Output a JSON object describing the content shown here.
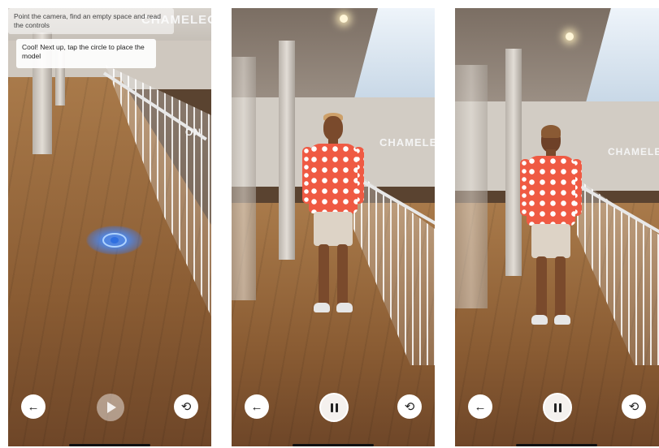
{
  "screens": [
    {
      "instruction_text": "Point the camera, find an empty space and read the controls",
      "tip_text": "Cool! Next up, tap the circle to place the model",
      "sign_text": "CHAMELEON",
      "sign_text_secondary": "ON",
      "controls": {
        "back_icon": "arrow-left-icon",
        "play_icon": "play-icon",
        "reset_icon": "rotate-ccw-icon"
      }
    },
    {
      "sign_text": "CHAMELEO",
      "controls": {
        "back_icon": "arrow-left-icon",
        "pause_icon": "pause-icon",
        "reset_icon": "rotate-ccw-icon"
      }
    },
    {
      "sign_text": "CHAMELE",
      "controls": {
        "back_icon": "arrow-left-icon",
        "pause_icon": "pause-icon",
        "reset_icon": "rotate-ccw-icon"
      }
    }
  ],
  "glyphs": {
    "back": "←",
    "reset": "⟲"
  },
  "colors": {
    "target_blue": "#2f6fe0",
    "shirt": "#ef5a43",
    "floor": "#a97a4a"
  }
}
